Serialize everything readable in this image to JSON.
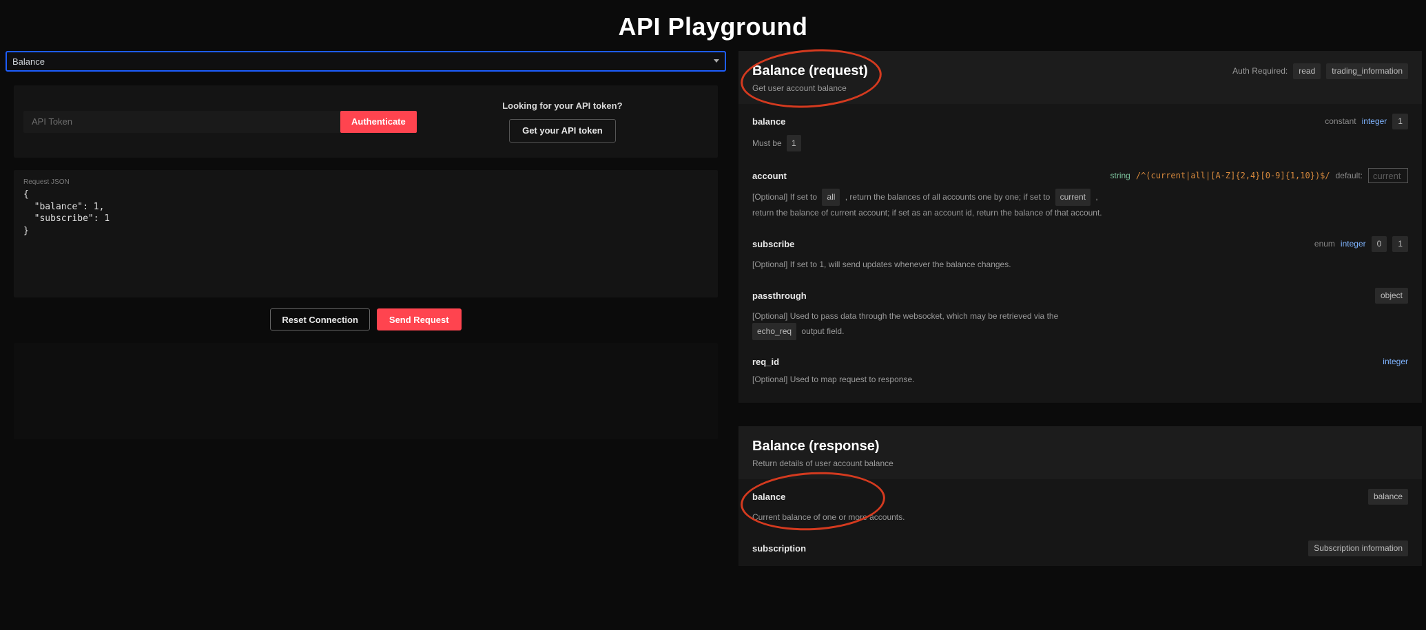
{
  "page_title": "API Playground",
  "select": {
    "value": "Balance"
  },
  "token": {
    "placeholder": "API Token",
    "auth_label": "Authenticate",
    "help_title": "Looking for your API token?",
    "get_token_label": "Get your API token"
  },
  "json": {
    "label": "Request JSON",
    "body": "{\n  \"balance\": 1,\n  \"subscribe\": 1\n}"
  },
  "buttons": {
    "reset": "Reset Connection",
    "send": "Send Request"
  },
  "request": {
    "title": "Balance (request)",
    "subtitle": "Get user account balance",
    "auth_label": "Auth Required:",
    "auth_scopes": [
      "read",
      "trading_information"
    ],
    "fields": {
      "balance": {
        "name": "balance",
        "kind": "constant",
        "type": "integer",
        "const_value": "1",
        "desc_prefix": "Must be"
      },
      "account": {
        "name": "account",
        "type": "string",
        "pattern": "/^(current|all|[A-Z]{2,4}[0-9]{1,10})$/",
        "default_label": "default:",
        "default_value": "current",
        "d1a": "[Optional] If set to ",
        "d1_tag1": "all",
        "d1b": " , return the balances of all accounts one by one; if set to ",
        "d1_tag2": "current",
        "d1c": " ,",
        "d2": "return the balance of current account; if set as an account id, return the balance of that account."
      },
      "subscribe": {
        "name": "subscribe",
        "kind": "enum",
        "type": "integer",
        "enum_values": [
          "0",
          "1"
        ],
        "desc": "[Optional] If set to 1, will send updates whenever the balance changes."
      },
      "passthrough": {
        "name": "passthrough",
        "type": "object",
        "d1": "[Optional] Used to pass data through the websocket, which may be retrieved via the",
        "d1_tag": "echo_req",
        "d2": " output field."
      },
      "req_id": {
        "name": "req_id",
        "type": "integer",
        "desc": "[Optional] Used to map request to response."
      }
    }
  },
  "response": {
    "title": "Balance (response)",
    "subtitle": "Return details of user account balance",
    "fields": {
      "balance": {
        "name": "balance",
        "type_tag": "balance",
        "desc": "Current balance of one or more accounts."
      },
      "subscription": {
        "name": "subscription",
        "type_tag": "Subscription information"
      }
    }
  }
}
